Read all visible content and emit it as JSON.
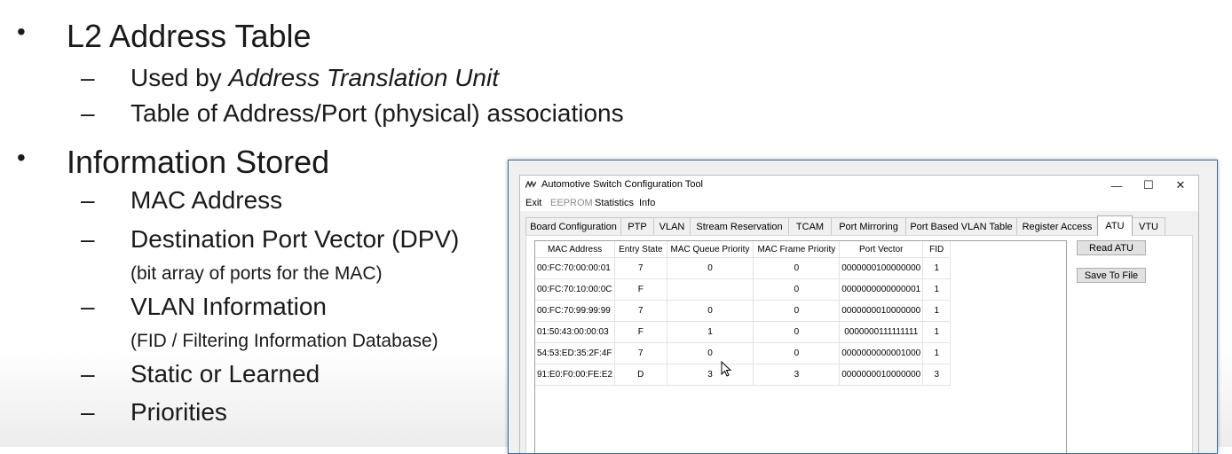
{
  "slide": {
    "bullets": [
      {
        "title": "L2 Address Table",
        "subs": [
          {
            "prefix": "Used by ",
            "emph": "Address Translation Unit"
          },
          {
            "text": "Table of Address/Port (physical) associations"
          }
        ]
      },
      {
        "title": "Information Stored",
        "subs": [
          {
            "text": "MAC Address"
          },
          {
            "text": "Destination Port Vector (DPV)",
            "note": "(bit array of ports for the MAC)"
          },
          {
            "text": "VLAN Information",
            "note": "(FID / Filtering Information Database)"
          },
          {
            "text": "Static or Learned"
          },
          {
            "text": "Priorities"
          }
        ]
      }
    ],
    "bullet_glyph": "•",
    "dash_glyph": "–"
  },
  "window": {
    "title": "Automotive Switch Configuration Tool",
    "icon": "app-logo-icon",
    "controls": {
      "minimize": "—",
      "maximize": "☐",
      "close": "✕"
    },
    "menu": [
      {
        "label": "Exit",
        "disabled": false
      },
      {
        "label": "EEPROM",
        "disabled": true
      },
      {
        "label": "Statistics",
        "disabled": false
      },
      {
        "label": "Info",
        "disabled": false
      }
    ],
    "tabs": [
      "Board Configuration",
      "PTP",
      "VLAN",
      "Stream Reservation",
      "TCAM",
      "Port Mirroring",
      "Port Based VLAN Table",
      "Register Access",
      "ATU",
      "VTU"
    ],
    "active_tab": "ATU",
    "table": {
      "columns": [
        "MAC Address",
        "Entry State",
        "MAC Queue Priority",
        "MAC Frame Priority",
        "Port Vector",
        "FID"
      ],
      "rows": [
        [
          "00:FC:70:00:00:01",
          "7",
          "0",
          "0",
          "0000000100000000",
          "1"
        ],
        [
          "00:FC:70:10:00:0C",
          "F",
          "",
          "0",
          "0000000000000001",
          "1"
        ],
        [
          "00:FC:70:99:99:99",
          "7",
          "0",
          "0",
          "0000000010000000",
          "1"
        ],
        [
          "01:50:43:00:00:03",
          "F",
          "1",
          "0",
          "0000000111111111",
          "1"
        ],
        [
          "54:53:ED:35:2F:4F",
          "7",
          "0",
          "0",
          "0000000000001000",
          "1"
        ],
        [
          "91:E0:F0:00:FE:E2",
          "D",
          "3",
          "3",
          "0000000010000000",
          "3"
        ]
      ]
    },
    "buttons": {
      "read": "Read ATU",
      "save": "Save To File"
    }
  }
}
